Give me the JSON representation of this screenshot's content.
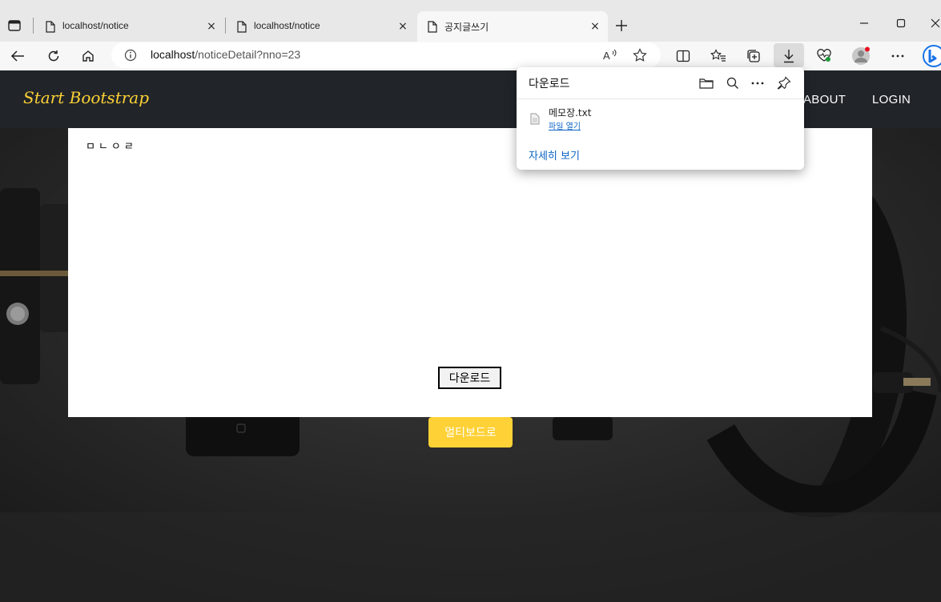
{
  "browser": {
    "tabs": [
      {
        "title": "localhost/notice",
        "active": false
      },
      {
        "title": "localhost/notice",
        "active": false
      },
      {
        "title": "공지글쓰기",
        "active": true
      }
    ],
    "close_glyph": "×",
    "new_tab_icon": "plus-icon",
    "address": {
      "host": "localhost",
      "path": "/noticeDetail?nno=23"
    },
    "toolbar_icons": [
      "read-aloud-icon",
      "favorite-star-icon",
      "split-screen-icon",
      "favorites-icon",
      "collections-icon",
      "download-icon",
      "performance-icon",
      "profile-icon",
      "more-icon",
      "bing-icon"
    ]
  },
  "downloads": {
    "title": "다운로드",
    "icons": [
      "folder-icon",
      "search-icon",
      "more-icon",
      "pin-icon"
    ],
    "file_name": "메모장.txt",
    "open_file": "파일 열기",
    "see_more": "자세히 보기"
  },
  "site": {
    "brand": "Start Bootstrap",
    "nav": [
      "ABOUT",
      "LOGIN"
    ],
    "accent_color": "#fed136",
    "navbar_color": "#212529"
  },
  "notice": {
    "content": "ㅁㄴㅇㄹ",
    "download_button": "다운로드",
    "board_button": "멀티보드로"
  }
}
